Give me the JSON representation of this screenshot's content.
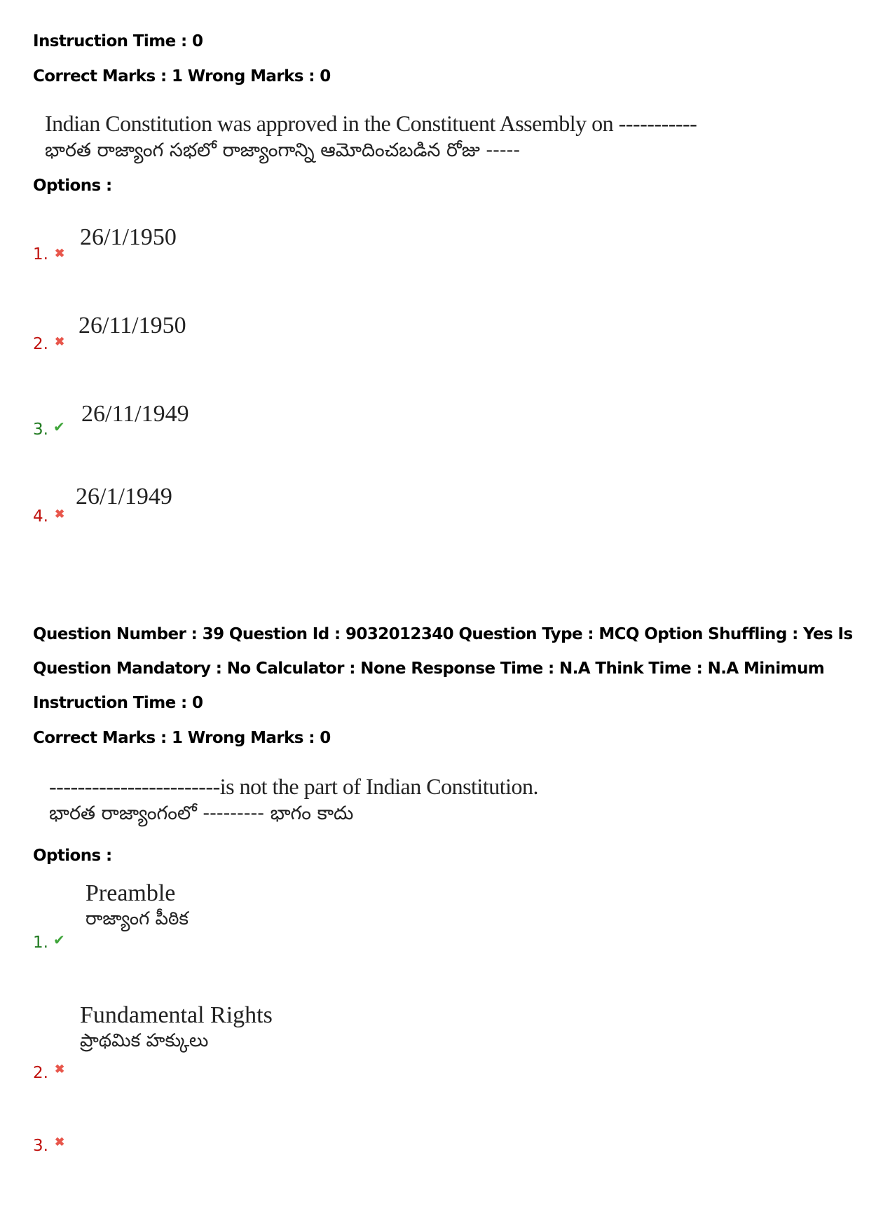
{
  "q38_tail": {
    "instruction_time": "Instruction Time : 0",
    "marks": "Correct Marks : 1 Wrong Marks : 0",
    "question_en": "Indian Constitution was approved in the Constituent Assembly on -----------",
    "question_te": "భారత రాజ్యాంగ సభలో రాజ్యాంగాన్ని ఆమోదించబడిన రోజు -----",
    "options_label": "Options :",
    "options": [
      {
        "num": "1.",
        "status": "wrong",
        "icon": "cross-icon",
        "text": "26/1/1950"
      },
      {
        "num": "2.",
        "status": "wrong",
        "icon": "cross-icon",
        "text": "26/11/1950"
      },
      {
        "num": "3.",
        "status": "correct",
        "icon": "check-icon",
        "text": "26/11/1949"
      },
      {
        "num": "4.",
        "status": "wrong",
        "icon": "cross-icon",
        "text": "26/1/1949"
      }
    ]
  },
  "q39": {
    "meta_line1": "Question Number : 39 Question Id : 9032012340 Question Type : MCQ Option Shuffling : Yes Is",
    "meta_line2": "Question Mandatory : No Calculator : None Response Time : N.A Think Time : N.A Minimum",
    "instruction_time": "Instruction Time : 0",
    "marks": "Correct Marks : 1 Wrong Marks : 0",
    "question_en": "------------------------is not the part of Indian Constitution.",
    "question_te": "భారత రాజ్యాంగంలో --------- భాగం కాదు",
    "options_label": "Options :",
    "options": [
      {
        "num": "1.",
        "status": "correct",
        "icon": "check-icon",
        "text_en": "Preamble",
        "text_te": "రాజ్యాంగ పీఠిక"
      },
      {
        "num": "2.",
        "status": "wrong",
        "icon": "cross-icon",
        "text_en": "Fundamental Rights",
        "text_te": "ప్రాథమిక హక్కులు"
      },
      {
        "num": "3.",
        "status": "wrong",
        "icon": "cross-icon",
        "text_en": "",
        "text_te": ""
      }
    ]
  },
  "colors": {
    "wrong": "#c0130f",
    "correct": "#1f7a1f",
    "cross_icon": "#e8564b",
    "check_icon": "#3fa53a"
  }
}
